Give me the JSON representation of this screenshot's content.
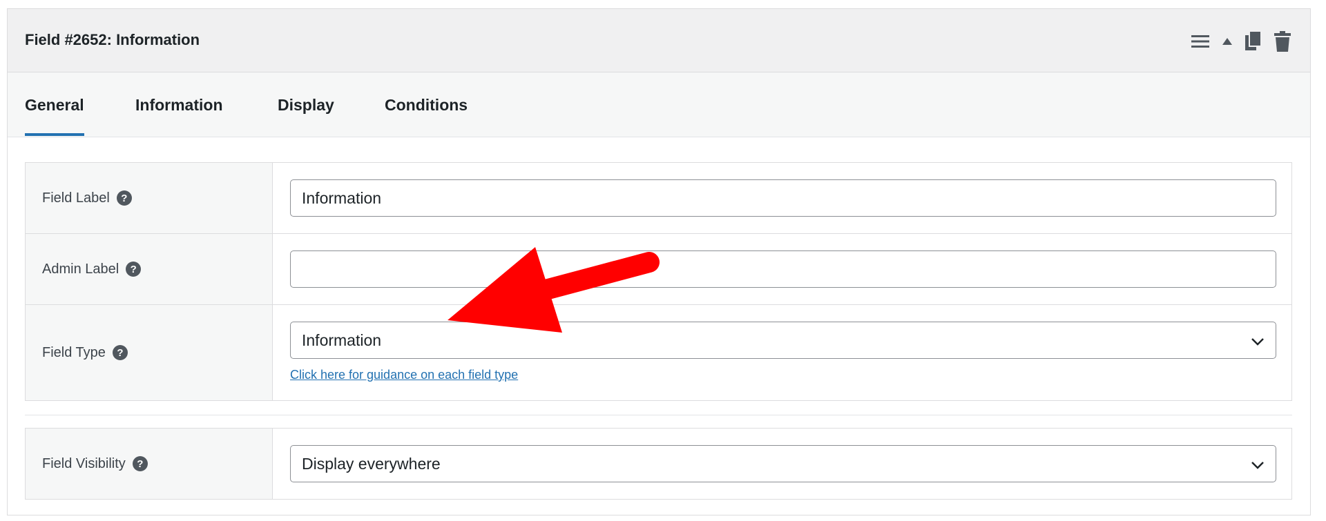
{
  "panel": {
    "title": "Field #2652: Information",
    "actions": {
      "menu_icon": "hamburger-icon",
      "collapse_icon": "caret-up-icon",
      "duplicate_icon": "copy-icon",
      "delete_icon": "trash-icon"
    }
  },
  "tabs": [
    {
      "label": "General",
      "active": true
    },
    {
      "label": "Information",
      "active": false
    },
    {
      "label": "Display",
      "active": false
    },
    {
      "label": "Conditions",
      "active": false
    }
  ],
  "rows": {
    "field_label": {
      "label": "Field Label",
      "value": "Information"
    },
    "admin_label": {
      "label": "Admin Label",
      "value": ""
    },
    "field_type": {
      "label": "Field Type",
      "value": "Information",
      "guidance_link": "Click here for guidance on each field type"
    },
    "field_visibility": {
      "label": "Field Visibility",
      "value": "Display everywhere"
    }
  },
  "help_icon_glyph": "?",
  "colors": {
    "accent": "#2271b1",
    "annotation_arrow": "#ff0000",
    "header_bg": "#f0f0f1"
  }
}
